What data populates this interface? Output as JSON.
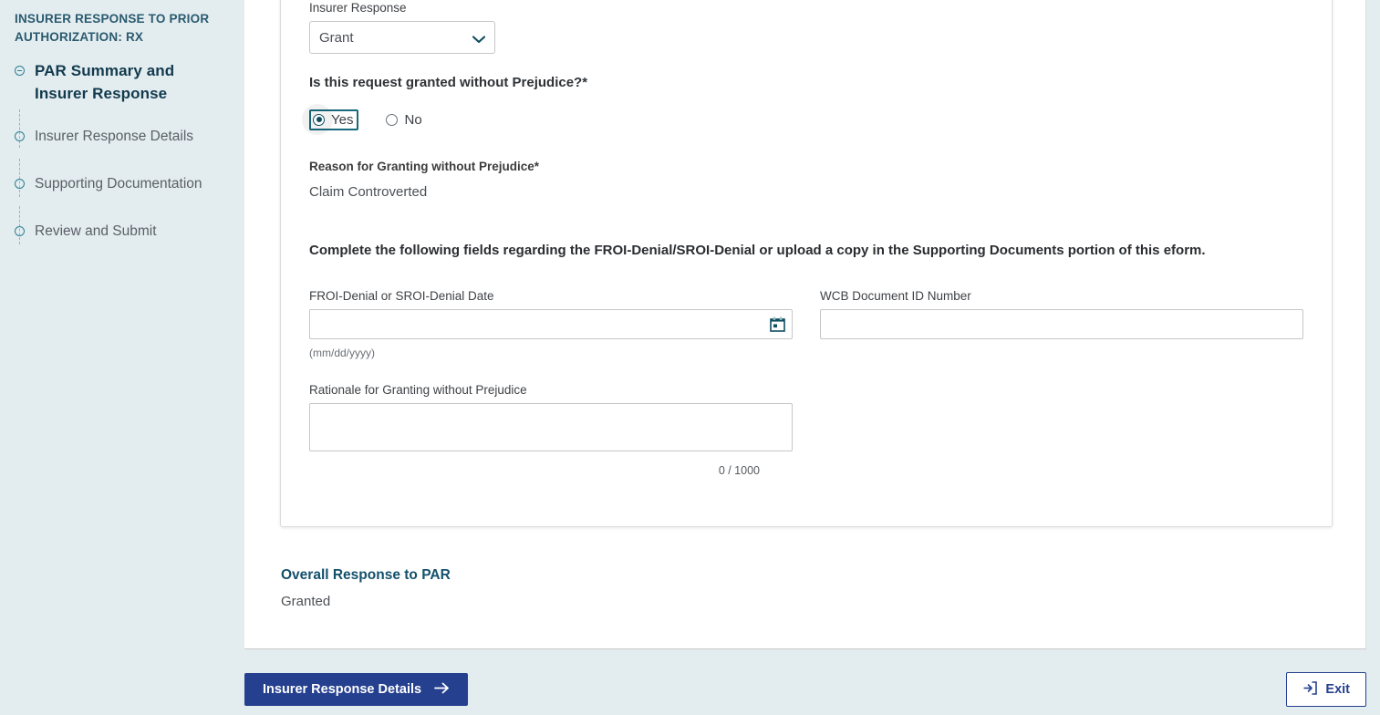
{
  "sidebar": {
    "title": "INSURER RESPONSE TO PRIOR AUTHORIZATION: RX",
    "items": [
      {
        "label": "PAR Summary and Insurer Response",
        "marker": "minus-circle-icon",
        "active": true
      },
      {
        "label": "Insurer Response Details",
        "marker": "circle-icon",
        "active": false
      },
      {
        "label": "Supporting Documentation",
        "marker": "circle-icon",
        "active": false
      },
      {
        "label": "Review and Submit",
        "marker": "circle-icon",
        "active": false
      }
    ]
  },
  "form": {
    "insurer_response_label": "Insurer Response",
    "insurer_response_value": "Grant",
    "insurer_response_options": [
      "Grant"
    ],
    "prejudice_question": "Is this request granted without Prejudice?*",
    "radio_yes": "Yes",
    "radio_no": "No",
    "radio_selected": "Yes",
    "reason_label": "Reason for Granting without Prejudice*",
    "reason_value": "Claim Controverted",
    "instruction": "Complete the following fields regarding the FROI-Denial/SROI-Denial or upload a copy in the Supporting Documents portion of this eform.",
    "denial_date_label": "FROI-Denial or SROI-Denial Date",
    "denial_date_value": "",
    "denial_date_hint": "(mm/dd/yyyy)",
    "wcb_doc_label": "WCB Document ID Number",
    "wcb_doc_value": "",
    "rationale_label": "Rationale for Granting without Prejudice",
    "rationale_value": "",
    "rationale_counter": "0 / 1000"
  },
  "overall": {
    "heading": "Overall Response to PAR",
    "value": "Granted"
  },
  "footer": {
    "next_label": "Insurer Response Details",
    "exit_label": "Exit"
  },
  "colors": {
    "page_background": "#e3edf0",
    "primary_button": "#25408f",
    "accent_teal": "#17697c",
    "heading_blue": "#14506b",
    "sidebar_title": "#2a5a6e"
  }
}
